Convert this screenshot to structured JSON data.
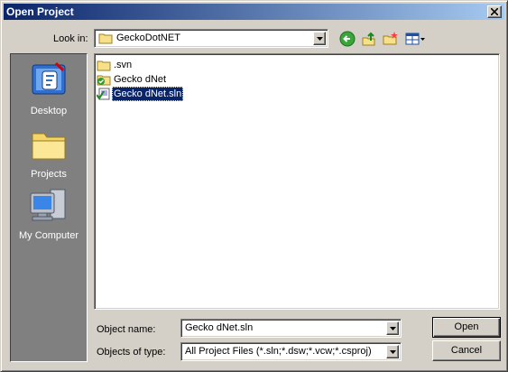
{
  "window": {
    "title": "Open Project"
  },
  "lookin": {
    "label": "Look in:",
    "value": "GeckoDotNET"
  },
  "toolbar": {
    "back_icon": "back-arrow-icon",
    "up_icon": "up-folder-icon",
    "newfolder_icon": "new-folder-icon",
    "views_icon": "views-menu-icon"
  },
  "places": [
    {
      "label": "Desktop",
      "icon": "desktop-icon"
    },
    {
      "label": "Projects",
      "icon": "folder-icon"
    },
    {
      "label": "My Computer",
      "icon": "computer-icon"
    }
  ],
  "files": [
    {
      "name": ".svn",
      "icon": "folder-icon"
    },
    {
      "name": "Gecko dNet",
      "icon": "project-folder-icon"
    },
    {
      "name": "Gecko dNet.sln",
      "icon": "solution-file-icon",
      "selected": true
    }
  ],
  "object_name": {
    "label": "Object name:",
    "value": "Gecko dNet.sln"
  },
  "object_type": {
    "label": "Objects of type:",
    "value": "All Project Files (*.sln;*.dsw;*.vcw;*.csproj)"
  },
  "buttons": {
    "open": "Open",
    "cancel": "Cancel"
  },
  "colors": {
    "title_start": "#0a246a",
    "title_end": "#a6caf0",
    "face": "#d4d0c8",
    "places_bg": "#808080",
    "selection": "#0a246a"
  }
}
